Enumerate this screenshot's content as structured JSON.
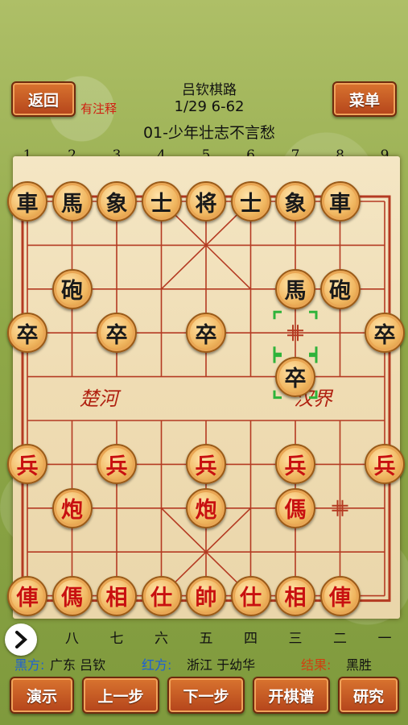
{
  "header": {
    "back_label": "返回",
    "menu_label": "菜单",
    "note_label": "有注释",
    "title": "吕钦棋路",
    "progress": "1/29 6-62",
    "game_title": "01-少年壮志不言愁"
  },
  "board": {
    "top_numbers": [
      "1",
      "2",
      "3",
      "4",
      "5",
      "6",
      "7",
      "8",
      "9"
    ],
    "bottom_numbers": [
      "九",
      "八",
      "七",
      "六",
      "五",
      "四",
      "三",
      "二",
      "一"
    ],
    "river_left": "楚河",
    "river_right": "汉界",
    "pieces": [
      {
        "t": "車",
        "c": "black",
        "f": 0,
        "r": 0
      },
      {
        "t": "馬",
        "c": "black",
        "f": 1,
        "r": 0
      },
      {
        "t": "象",
        "c": "black",
        "f": 2,
        "r": 0
      },
      {
        "t": "士",
        "c": "black",
        "f": 3,
        "r": 0
      },
      {
        "t": "将",
        "c": "black",
        "f": 4,
        "r": 0
      },
      {
        "t": "士",
        "c": "black",
        "f": 5,
        "r": 0
      },
      {
        "t": "象",
        "c": "black",
        "f": 6,
        "r": 0
      },
      {
        "t": "車",
        "c": "black",
        "f": 7,
        "r": 0
      },
      {
        "t": "砲",
        "c": "black",
        "f": 1,
        "r": 2
      },
      {
        "t": "馬",
        "c": "black",
        "f": 6,
        "r": 2
      },
      {
        "t": "砲",
        "c": "black",
        "f": 7,
        "r": 2
      },
      {
        "t": "卒",
        "c": "black",
        "f": 0,
        "r": 3
      },
      {
        "t": "卒",
        "c": "black",
        "f": 2,
        "r": 3
      },
      {
        "t": "卒",
        "c": "black",
        "f": 4,
        "r": 3
      },
      {
        "t": "卒",
        "c": "black",
        "f": 8,
        "r": 3
      },
      {
        "t": "卒",
        "c": "black",
        "f": 6,
        "r": 4
      },
      {
        "t": "兵",
        "c": "red",
        "f": 0,
        "r": 6
      },
      {
        "t": "兵",
        "c": "red",
        "f": 2,
        "r": 6
      },
      {
        "t": "兵",
        "c": "red",
        "f": 4,
        "r": 6
      },
      {
        "t": "兵",
        "c": "red",
        "f": 6,
        "r": 6
      },
      {
        "t": "兵",
        "c": "red",
        "f": 8,
        "r": 6
      },
      {
        "t": "炮",
        "c": "red",
        "f": 1,
        "r": 7
      },
      {
        "t": "炮",
        "c": "red",
        "f": 4,
        "r": 7
      },
      {
        "t": "傌",
        "c": "red",
        "f": 6,
        "r": 7
      },
      {
        "t": "俥",
        "c": "red",
        "f": 0,
        "r": 9
      },
      {
        "t": "傌",
        "c": "red",
        "f": 1,
        "r": 9
      },
      {
        "t": "相",
        "c": "red",
        "f": 2,
        "r": 9
      },
      {
        "t": "仕",
        "c": "red",
        "f": 3,
        "r": 9
      },
      {
        "t": "帥",
        "c": "red",
        "f": 4,
        "r": 9
      },
      {
        "t": "仕",
        "c": "red",
        "f": 5,
        "r": 9
      },
      {
        "t": "相",
        "c": "red",
        "f": 6,
        "r": 9
      },
      {
        "t": "俥",
        "c": "red",
        "f": 7,
        "r": 9
      }
    ]
  },
  "info": {
    "black_label": "黑方:",
    "black_player": "广东 吕钦",
    "red_label": "红方:",
    "red_player": "浙江 于幼华",
    "result_label": "结果:",
    "result_value": "黑胜"
  },
  "toolbar": {
    "demo_label": "演示",
    "prev_label": "上一步",
    "next_label": "下一步",
    "open_label": "开棋谱",
    "study_label": "研究"
  },
  "colors": {
    "line": "#b43a22",
    "red_piece": "#c81010",
    "black_piece": "#1a1a1a",
    "highlight": "#2fb33a",
    "button": "#c2562a"
  }
}
